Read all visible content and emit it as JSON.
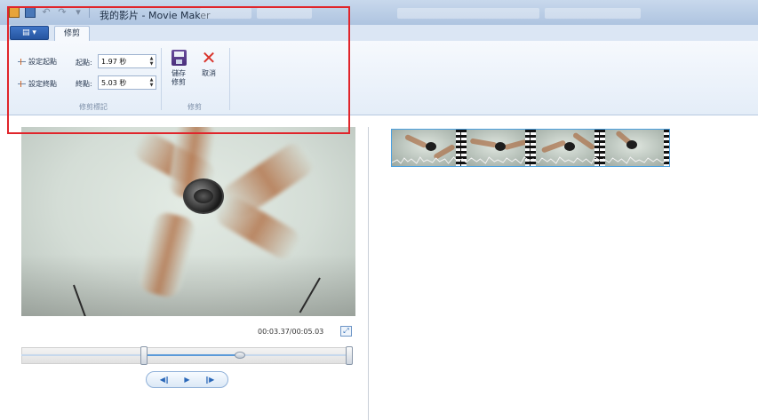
{
  "window": {
    "title": "我的影片 - Movie Maker",
    "taskbar_items": [
      "",
      "",
      "",
      "",
      ""
    ]
  },
  "ribbon": {
    "file_menu_label": "",
    "active_tab": "修剪",
    "trim_points": {
      "set_start_label": "設定起點",
      "set_end_label": "設定終點",
      "start_label": "起點:",
      "start_value": "1.97 秒",
      "end_label": "終點:",
      "end_value": "5.03 秒",
      "group_label": "修剪標記"
    },
    "trim": {
      "save_label": "儲存\n修剪",
      "cancel_label": "取消",
      "group_label": "修剪"
    }
  },
  "player": {
    "timecode": "00:03.37/00:05.03",
    "trim_start_fraction": 0.37,
    "trim_end_fraction": 0.99,
    "playhead_fraction": 0.66
  },
  "icons": {
    "app": "movie-maker-icon",
    "save": "floppy-disk-icon",
    "undo": "undo-icon",
    "redo": "redo-icon",
    "cancel": "red-x-icon",
    "expand": "expand-icon",
    "prev_frame": "previous-frame-icon",
    "play": "play-icon",
    "next_frame": "next-frame-icon"
  },
  "colors": {
    "highlight_border": "#e0252b",
    "accent": "#2d6bb3",
    "cancel": "#d9342b"
  }
}
